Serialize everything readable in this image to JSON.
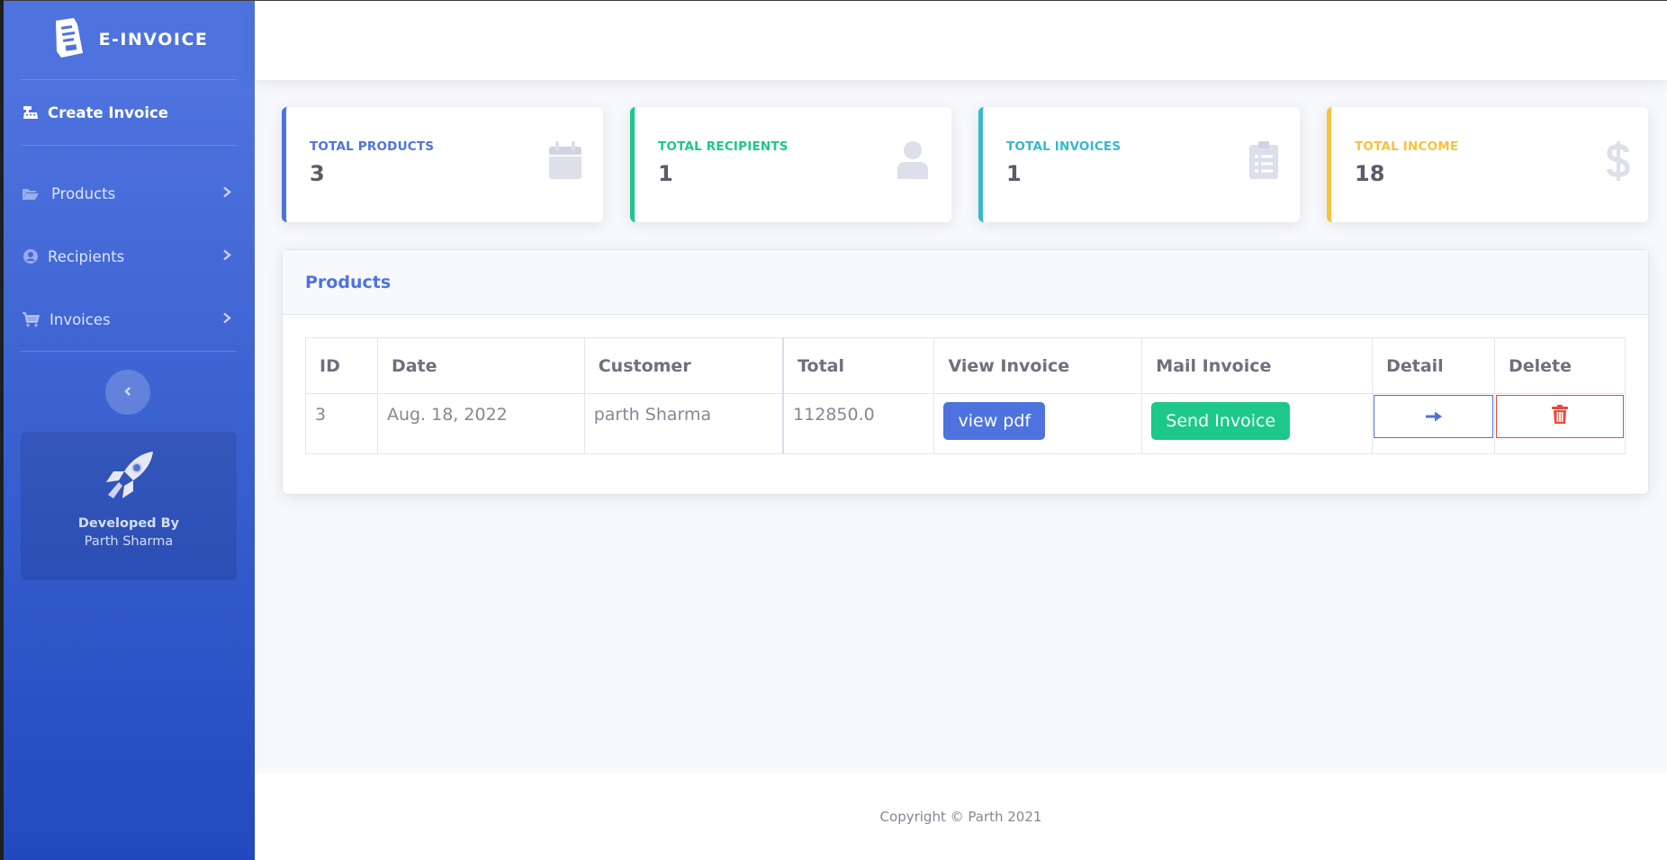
{
  "brand": {
    "name": "E-INVOICE"
  },
  "sidebar": {
    "create_label": "Create Invoice",
    "items": [
      {
        "label": "Products"
      },
      {
        "label": "Recipients"
      },
      {
        "label": "Invoices"
      }
    ],
    "promo": {
      "title": "Developed By",
      "name": "Parth Sharma"
    }
  },
  "stats": [
    {
      "label": "TOTAL PRODUCTS",
      "value": "3",
      "color": "#4e73df",
      "icon": "calendar-icon"
    },
    {
      "label": "TOTAL RECIPIENTS",
      "value": "1",
      "color": "#1cc88a",
      "icon": "user-icon"
    },
    {
      "label": "TOTAL INVOICES",
      "value": "1",
      "color": "#36b9cc",
      "icon": "clipboard-list-icon"
    },
    {
      "label": "TOTAL INCOME",
      "value": "18",
      "color": "#f6c23e",
      "icon": "dollar-icon"
    }
  ],
  "products_panel": {
    "title": "Products",
    "columns": [
      "ID",
      "Date",
      "Customer",
      "Total",
      "View Invoice",
      "Mail Invoice",
      "Detail",
      "Delete"
    ],
    "rows": [
      {
        "id": "3",
        "date": "Aug. 18, 2022",
        "customer": "parth Sharma",
        "total": "112850.0",
        "view_label": "view pdf",
        "mail_label": "Send Invoice"
      }
    ]
  },
  "footer": {
    "text": "Copyright © Parth 2021"
  },
  "colors": {
    "primary": "#4e73df",
    "success": "#1cc88a",
    "info": "#36b9cc",
    "warning": "#f6c23e",
    "danger": "#e74a3b"
  }
}
